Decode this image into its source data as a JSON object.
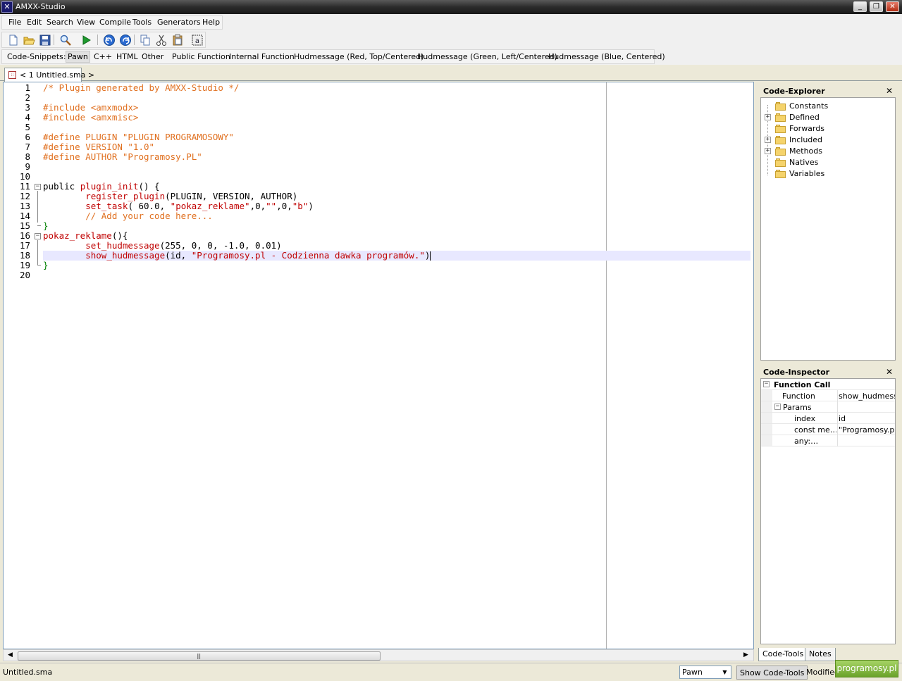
{
  "window": {
    "title": "AMXX-Studio",
    "icon": "amxx-logo-icon",
    "controls": [
      "minimize",
      "maximize",
      "close"
    ]
  },
  "menubar": {
    "items": [
      "File",
      "Edit",
      "Search",
      "View",
      "Compile",
      "Tools",
      "Generators",
      "Help"
    ]
  },
  "toolbar": {
    "buttons": [
      "new-file-icon",
      "open-folder-icon",
      "save-icon",
      "find-icon",
      "run-icon",
      "undo-icon",
      "redo-icon",
      "copy-icon",
      "cut-icon",
      "paste-icon",
      "select-all-icon"
    ]
  },
  "snippets": {
    "label": "Code-Snippets:",
    "active": "Pawn",
    "items": [
      "Pawn",
      "C++",
      "HTML",
      "Other",
      "Public Function",
      "Internal Function",
      "Hudmessage (Red, Top/Centered)",
      "Hudmessage (Green, Left/Centered)",
      "Hudmessage (Blue, Centered)"
    ]
  },
  "tabs": {
    "document": "< 1 Untitled.sma >"
  },
  "editor": {
    "current_line": 18,
    "lines": [
      "/* Plugin generated by AMXX-Studio */",
      "",
      "#include <amxmodx>",
      "#include <amxmisc>",
      "",
      "#define PLUGIN \"PLUGIN PROGRAMOSOWY\"",
      "#define VERSION \"1.0\"",
      "#define AUTHOR \"Programosy.PL\"",
      "",
      "",
      "public plugin_init() {",
      "        register_plugin(PLUGIN, VERSION, AUTHOR)",
      "        set_task( 60.0, \"pokaz_reklame\",0,\"\",0,\"b\")",
      "        // Add your code here...",
      "}",
      "pokaz_reklame(){",
      "        set_hudmessage(255, 0, 0, -1.0, 0.01)",
      "        show_hudmessage(id, \"Programosy.pl - Codzienna dawka programów.\")",
      "}",
      ""
    ]
  },
  "code_explorer": {
    "title": "Code-Explorer",
    "items": [
      {
        "label": "Constants",
        "expandable": false
      },
      {
        "label": "Defined",
        "expandable": true
      },
      {
        "label": "Forwards",
        "expandable": false
      },
      {
        "label": "Included",
        "expandable": true
      },
      {
        "label": "Methods",
        "expandable": true
      },
      {
        "label": "Natives",
        "expandable": false
      },
      {
        "label": "Variables",
        "expandable": false
      }
    ]
  },
  "code_inspector": {
    "title": "Code-Inspector",
    "section": "Function Call",
    "function_key": "Function",
    "function_val": "show_hudmessa",
    "params_label": "Params",
    "params": [
      {
        "key": "index",
        "val": "id"
      },
      {
        "key": "const me…",
        "val": "\"Programosy.pl -"
      },
      {
        "key": "any:…",
        "val": ""
      }
    ]
  },
  "panel_tabs": [
    "Code-Tools",
    "Notes"
  ],
  "statusbar": {
    "file": "Untitled.sma",
    "language": "Pawn",
    "toggle": "Show Code-Tools",
    "state": "Modified"
  },
  "watermark": "programosy.pl"
}
